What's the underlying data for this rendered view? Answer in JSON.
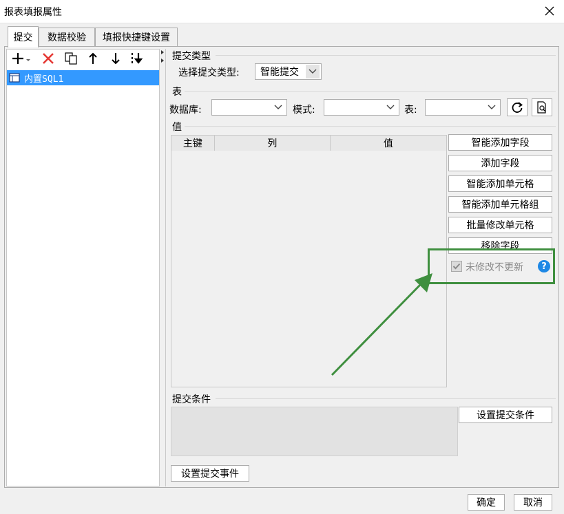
{
  "window": {
    "title": "报表填报属性"
  },
  "tabs": [
    "提交",
    "数据校验",
    "填报快捷键设置"
  ],
  "left_tree": {
    "items": [
      {
        "label": "内置SQL1",
        "selected": true
      }
    ]
  },
  "submit_type": {
    "group_label": "提交类型",
    "label": "选择提交类型:",
    "value": "智能提交"
  },
  "table_section": {
    "group_label": "表",
    "database_label": "数据库:",
    "database_value": "",
    "schema_label": "模式:",
    "schema_value": "",
    "table_label": "表:",
    "table_value": ""
  },
  "value_section": {
    "group_label": "值",
    "columns": [
      "主键",
      "列",
      "值"
    ],
    "rows": [],
    "buttons": [
      "智能添加字段",
      "添加字段",
      "智能添加单元格",
      "智能添加单元格组",
      "批量修改单元格",
      "移除字段"
    ],
    "checkbox_label": "未修改不更新",
    "checkbox_checked": true,
    "help_glyph": "?"
  },
  "condition_section": {
    "group_label": "提交条件",
    "button": "设置提交条件"
  },
  "event_button": "设置提交事件",
  "footer": {
    "ok": "确定",
    "cancel": "取消"
  },
  "colors": {
    "accent": "#3399ff",
    "highlight_box": "#3f8f3f",
    "help_icon": "#1e88e5"
  }
}
